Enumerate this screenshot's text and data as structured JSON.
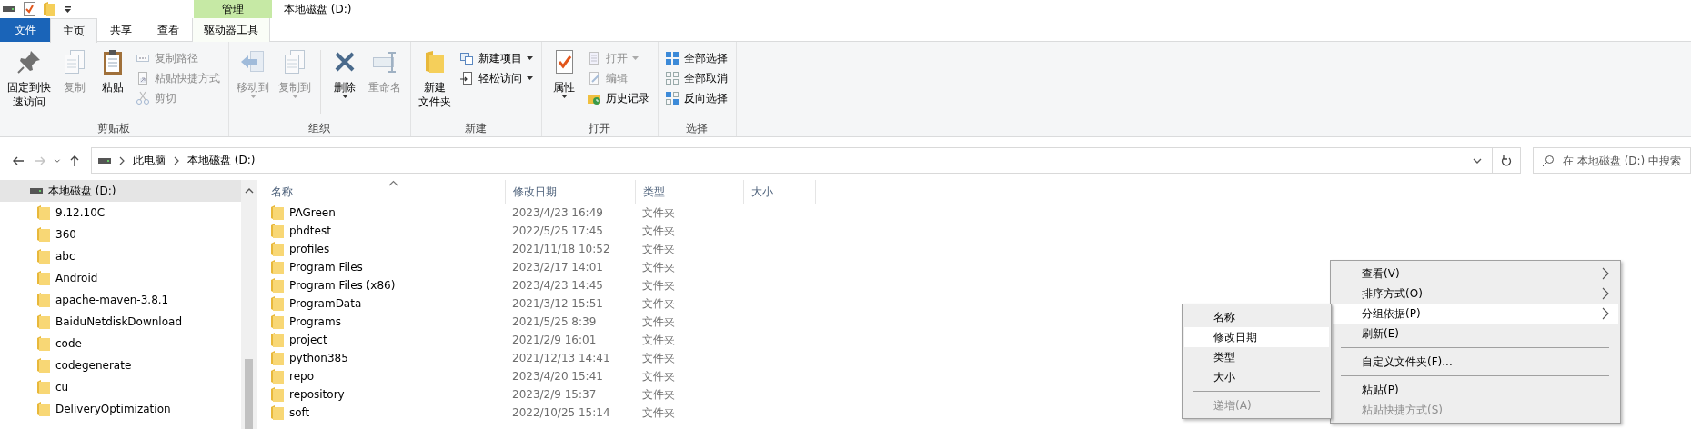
{
  "title_bar": {
    "title": "本地磁盘 (D:)",
    "contextual_group": "管理"
  },
  "tabs": [
    {
      "label": "文件",
      "kind": "file",
      "selected": false
    },
    {
      "label": "主页",
      "kind": "tab",
      "selected": true
    },
    {
      "label": "共享",
      "kind": "tab",
      "selected": false
    },
    {
      "label": "查看",
      "kind": "tab",
      "selected": false
    },
    {
      "label": "驱动器工具",
      "kind": "contextual",
      "selected": false
    }
  ],
  "ribbon": {
    "groups": [
      {
        "label": "剪贴板",
        "items": [
          {
            "kind": "large",
            "lines": [
              "固定到快",
              "速访问"
            ],
            "disabled": false,
            "dropdown": false
          },
          {
            "kind": "large",
            "lines": [
              "复制"
            ],
            "disabled": true,
            "dropdown": false
          },
          {
            "kind": "large",
            "lines": [
              "粘贴"
            ],
            "disabled": false,
            "dropdown": false
          },
          {
            "kind": "stack",
            "buttons": [
              {
                "label": "复制路径",
                "disabled": true,
                "dropdown": false
              },
              {
                "label": "粘贴快捷方式",
                "disabled": true,
                "dropdown": false
              },
              {
                "label": "剪切",
                "disabled": true,
                "dropdown": false
              }
            ]
          }
        ]
      },
      {
        "label": "组织",
        "items": [
          {
            "kind": "large",
            "lines": [
              "移动到"
            ],
            "disabled": true,
            "dropdown": true
          },
          {
            "kind": "large",
            "lines": [
              "复制到"
            ],
            "disabled": true,
            "dropdown": true
          },
          {
            "kind": "divider"
          },
          {
            "kind": "large",
            "lines": [
              "删除"
            ],
            "disabled": false,
            "dropdown": true
          },
          {
            "kind": "large",
            "lines": [
              "重命名"
            ],
            "disabled": true,
            "dropdown": false
          }
        ]
      },
      {
        "label": "新建",
        "items": [
          {
            "kind": "large",
            "lines": [
              "新建",
              "文件夹"
            ],
            "disabled": false,
            "dropdown": false
          },
          {
            "kind": "stack",
            "buttons": [
              {
                "label": "新建项目",
                "disabled": false,
                "dropdown": true
              },
              {
                "label": "轻松访问",
                "disabled": false,
                "dropdown": true
              }
            ]
          }
        ]
      },
      {
        "label": "打开",
        "items": [
          {
            "kind": "large",
            "lines": [
              "属性"
            ],
            "disabled": false,
            "dropdown": true
          },
          {
            "kind": "stack",
            "buttons": [
              {
                "label": "打开",
                "disabled": true,
                "dropdown": true
              },
              {
                "label": "编辑",
                "disabled": true,
                "dropdown": false
              },
              {
                "label": "历史记录",
                "disabled": false,
                "dropdown": false
              }
            ]
          }
        ]
      },
      {
        "label": "选择",
        "items": [
          {
            "kind": "stack",
            "buttons": [
              {
                "label": "全部选择",
                "disabled": false,
                "dropdown": false
              },
              {
                "label": "全部取消",
                "disabled": false,
                "dropdown": false
              },
              {
                "label": "反向选择",
                "disabled": false,
                "dropdown": false
              }
            ]
          }
        ]
      }
    ]
  },
  "navigation": {
    "buttons": [
      {
        "kind": "back",
        "disabled": false
      },
      {
        "kind": "forward",
        "disabled": true
      },
      {
        "kind": "recent",
        "disabled": false
      },
      {
        "kind": "up",
        "disabled": false
      }
    ],
    "crumbs": [
      "此电脑",
      "本地磁盘 (D:)"
    ],
    "search": {
      "placeholder": "在 本地磁盘 (D:) 中搜索"
    }
  },
  "sidebar": {
    "items": [
      {
        "label": "本地磁盘 (D:)",
        "kind": "drive",
        "selected": true,
        "children": [
          {
            "label": "9.12.10C",
            "kind": "folder",
            "selected": false
          },
          {
            "label": "360",
            "kind": "folder",
            "selected": false
          },
          {
            "label": "abc",
            "kind": "folder",
            "selected": false
          },
          {
            "label": "Android",
            "kind": "folder",
            "selected": false
          },
          {
            "label": "apache-maven-3.8.1",
            "kind": "folder",
            "selected": false
          },
          {
            "label": "BaiduNetdiskDownload",
            "kind": "folder",
            "selected": false
          },
          {
            "label": "code",
            "kind": "folder",
            "selected": false
          },
          {
            "label": "codegenerate",
            "kind": "folder",
            "selected": false
          },
          {
            "label": "cu",
            "kind": "folder",
            "selected": false
          },
          {
            "label": "DeliveryOptimization",
            "kind": "folder",
            "selected": false
          }
        ]
      }
    ]
  },
  "file_list": {
    "columns": [
      {
        "label": "名称",
        "sorted": true
      },
      {
        "label": "修改日期",
        "sorted": false
      },
      {
        "label": "类型",
        "sorted": false
      },
      {
        "label": "大小",
        "sorted": false
      }
    ],
    "rows": [
      {
        "name": "PAGreen",
        "modified": "2023/4/23 16:49",
        "type": "文件夹"
      },
      {
        "name": "phdtest",
        "modified": "2022/5/25 17:45",
        "type": "文件夹"
      },
      {
        "name": "profiles",
        "modified": "2021/11/18 10:52",
        "type": "文件夹"
      },
      {
        "name": "Program Files",
        "modified": "2023/2/17 14:01",
        "type": "文件夹"
      },
      {
        "name": "Program Files (x86)",
        "modified": "2023/4/23 14:45",
        "type": "文件夹"
      },
      {
        "name": "ProgramData",
        "modified": "2021/3/12 15:51",
        "type": "文件夹"
      },
      {
        "name": "Programs",
        "modified": "2021/5/25 8:39",
        "type": "文件夹"
      },
      {
        "name": "project",
        "modified": "2021/2/9 16:01",
        "type": "文件夹"
      },
      {
        "name": "python385",
        "modified": "2021/12/13 14:41",
        "type": "文件夹"
      },
      {
        "name": "repo",
        "modified": "2023/4/20 15:41",
        "type": "文件夹"
      },
      {
        "name": "repository",
        "modified": "2023/2/9 15:37",
        "type": "文件夹"
      },
      {
        "name": "soft",
        "modified": "2022/10/25 15:14",
        "type": "文件夹"
      }
    ]
  },
  "context_menu": {
    "items": [
      {
        "kind": "item",
        "label": "查看(V)",
        "submenu": true,
        "highlighted": false,
        "disabled": false
      },
      {
        "kind": "item",
        "label": "排序方式(O)",
        "submenu": true,
        "highlighted": false,
        "disabled": false
      },
      {
        "kind": "item",
        "label": "分组依据(P)",
        "submenu": true,
        "highlighted": true,
        "disabled": false
      },
      {
        "kind": "item",
        "label": "刷新(E)",
        "submenu": false,
        "highlighted": false,
        "disabled": false
      },
      {
        "kind": "separator"
      },
      {
        "kind": "item",
        "label": "自定义文件夹(F)...",
        "submenu": false,
        "highlighted": false,
        "disabled": false
      },
      {
        "kind": "separator"
      },
      {
        "kind": "item",
        "label": "粘贴(P)",
        "submenu": false,
        "highlighted": false,
        "disabled": false
      },
      {
        "kind": "item",
        "label": "粘贴快捷方式(S)",
        "submenu": false,
        "highlighted": false,
        "disabled": true
      }
    ]
  },
  "submenu": {
    "items": [
      {
        "kind": "item",
        "label": "名称",
        "highlighted": false,
        "disabled": false
      },
      {
        "kind": "item",
        "label": "修改日期",
        "highlighted": true,
        "disabled": false
      },
      {
        "kind": "item",
        "label": "类型",
        "highlighted": false,
        "disabled": false
      },
      {
        "kind": "item",
        "label": "大小",
        "highlighted": false,
        "disabled": false
      },
      {
        "kind": "separator"
      },
      {
        "kind": "item",
        "label": "递增(A)",
        "highlighted": false,
        "disabled": true
      }
    ]
  }
}
